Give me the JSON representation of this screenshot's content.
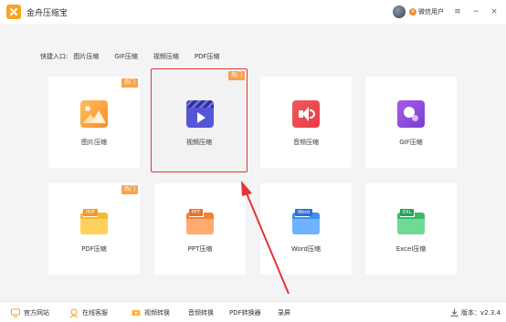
{
  "app": {
    "title": "金舟压缩宝"
  },
  "user": {
    "name": "微信用户"
  },
  "window_controls": {
    "menu": "≡",
    "minimize": "−",
    "close": "×"
  },
  "quick_access": {
    "label": "快捷入口:",
    "links": [
      "图片压缩",
      "GIF压缩",
      "视频压缩",
      "PDF压缩"
    ]
  },
  "cards": [
    {
      "label": "图片压缩",
      "badge": "热门",
      "icon": "image-compress-icon"
    },
    {
      "label": "视频压缩",
      "badge": "热门",
      "icon": "video-compress-icon",
      "selected": true
    },
    {
      "label": "音频压缩",
      "badge": "",
      "icon": "audio-compress-icon"
    },
    {
      "label": "GIF压缩",
      "badge": "",
      "icon": "gif-compress-icon"
    },
    {
      "label": "PDF压缩",
      "badge": "热门",
      "icon": "pdf-folder-icon",
      "tag": "PDF"
    },
    {
      "label": "PPT压缩",
      "badge": "",
      "icon": "ppt-folder-icon",
      "tag": "PPT"
    },
    {
      "label": "Word压缩",
      "badge": "",
      "icon": "word-folder-icon",
      "tag": "Word"
    },
    {
      "label": "Excel压缩",
      "badge": "",
      "icon": "excel-folder-icon",
      "tag": "EXL"
    }
  ],
  "footer": {
    "website": "官方网站",
    "support": "在线客服",
    "links": [
      "视频转换",
      "音频转换",
      "PDF转换器",
      "录屏"
    ],
    "version": "版本：v2.3.4"
  },
  "colors": {
    "selection_border": "#e43535",
    "badge": "#f7a34b",
    "accent_orange": "#f6a623"
  }
}
